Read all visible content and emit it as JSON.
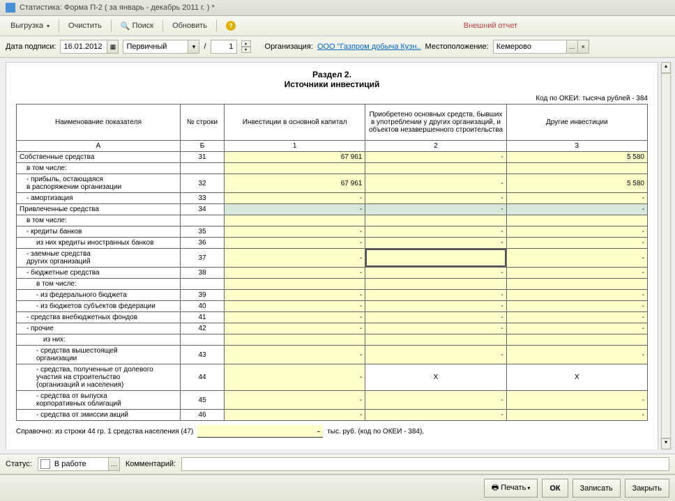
{
  "title": "Статистика: Форма П-2 ( за январь - декабрь 2011 г. ) *",
  "toolbar": {
    "export": "Выгрузка",
    "clear": "Очистить",
    "search": "Поиск",
    "refresh": "Обновить",
    "ext_report": "Внешний отчет"
  },
  "params": {
    "date_label": "Дата подписи:",
    "date_value": "16.01.2012",
    "type_value": "Первичный",
    "slash": "/",
    "number": "1",
    "org_label": "Организация:",
    "org_value": "ООО \"Газпром добыча Кузн..",
    "loc_label": "Местоположение:",
    "loc_value": "Кемерово"
  },
  "section": {
    "title": "Раздел 2.",
    "subtitle": "Источники инвестиций",
    "okei": "Код по ОКЕИ: тысяча рублей - 384"
  },
  "headers": {
    "h0": "Наименование показателя",
    "h1": "№ строки",
    "h2": "Инвестиции в основной капитал",
    "h3": "Приобретено основных средств, бывших в употреблении у других организаций, и объектов незавершенного строительства",
    "h4": "Другие инвестиции",
    "s0": "А",
    "s1": "Б",
    "s2": "1",
    "s3": "2",
    "s4": "3"
  },
  "rows": [
    {
      "name": "Собственные средства",
      "num": "31",
      "v1": "67 961",
      "v2": "-",
      "v3": "5 580",
      "ind": 0,
      "gray": false
    },
    {
      "name": "в том числе:",
      "num": "",
      "v1": "",
      "v2": "",
      "v3": "",
      "ind": 1,
      "blank": true
    },
    {
      "name": "- прибыль, остающаяся",
      "num": "",
      "v1": "",
      "v2": "",
      "v3": "",
      "ind": 1,
      "cont": true
    },
    {
      "name": "в распоряжении организации",
      "num": "32",
      "v1": "67 961",
      "v2": "-",
      "v3": "5 580",
      "ind": 1
    },
    {
      "name": "- амортизация",
      "num": "33",
      "v1": "-",
      "v2": "-",
      "v3": "-",
      "ind": 1
    },
    {
      "name": "Привлеченные средства",
      "num": "34",
      "v1": "-",
      "v2": "-",
      "v3": "-",
      "ind": 0,
      "gray": true
    },
    {
      "name": "в том числе:",
      "num": "",
      "v1": "",
      "v2": "",
      "v3": "",
      "ind": 1,
      "blank": true
    },
    {
      "name": "- кредиты банков",
      "num": "35",
      "v1": "-",
      "v2": "-",
      "v3": "-",
      "ind": 1
    },
    {
      "name": "из них кредиты иностранных банков",
      "num": "36",
      "v1": "-",
      "v2": "-",
      "v3": "-",
      "ind": 2
    },
    {
      "name": "- заемные средства",
      "num": "",
      "v1": "",
      "v2": "",
      "v3": "",
      "ind": 1,
      "cont": true
    },
    {
      "name": "других организаций",
      "num": "37",
      "v1": "-",
      "v2": "-",
      "v3": "-",
      "ind": 1,
      "sel": true
    },
    {
      "name": "- бюджетные средства",
      "num": "38",
      "v1": "-",
      "v2": "-",
      "v3": "-",
      "ind": 1
    },
    {
      "name": "в том числе:",
      "num": "",
      "v1": "",
      "v2": "",
      "v3": "",
      "ind": 2,
      "blank": true
    },
    {
      "name": "- из федерального бюджета",
      "num": "39",
      "v1": "-",
      "v2": "-",
      "v3": "-",
      "ind": 2
    },
    {
      "name": "- из бюджетов субъектов федерации",
      "num": "40",
      "v1": "-",
      "v2": "-",
      "v3": "-",
      "ind": 2
    },
    {
      "name": "- средства внебюджетных фондов",
      "num": "41",
      "v1": "-",
      "v2": "-",
      "v3": "-",
      "ind": 1
    },
    {
      "name": "- прочие",
      "num": "42",
      "v1": "-",
      "v2": "-",
      "v3": "-",
      "ind": 1
    },
    {
      "name": "из них:",
      "num": "",
      "v1": "",
      "v2": "",
      "v3": "",
      "ind": 3,
      "blank": true
    },
    {
      "name": "- средства вышестоящей",
      "num": "",
      "v1": "",
      "v2": "",
      "v3": "",
      "ind": 2,
      "cont": true
    },
    {
      "name": "организации",
      "num": "43",
      "v1": "-",
      "v2": "-",
      "v3": "-",
      "ind": 0
    },
    {
      "name": "- средства, полученные от долевого",
      "num": "",
      "v1": "",
      "v2": "",
      "v3": "",
      "ind": 2,
      "cont": true
    },
    {
      "name": "участия на строительство",
      "num": "",
      "v1": "",
      "v2": "",
      "v3": "",
      "ind": 3,
      "cont": true
    },
    {
      "name": "(организаций и населения)",
      "num": "44",
      "v1": "-",
      "v2": "X",
      "v3": "X",
      "ind": 3,
      "xcells": true
    },
    {
      "name": "- средства от выпуска",
      "num": "",
      "v1": "",
      "v2": "",
      "v3": "",
      "ind": 2,
      "cont": true
    },
    {
      "name": "корпоративных облигаций",
      "num": "45",
      "v1": "-",
      "v2": "-",
      "v3": "-",
      "ind": 3
    },
    {
      "name": "- средства от эмиссии акций",
      "num": "46",
      "v1": "-",
      "v2": "-",
      "v3": "-",
      "ind": 2
    }
  ],
  "footnote": {
    "text1": "Справочно: из строки 44 гр. 1 средства населения (47)",
    "value": "-",
    "text2": "тыс. руб. (код по ОКЕИ - 384)."
  },
  "status": {
    "label": "Статус:",
    "value": "В работе",
    "comment_label": "Комментарий:",
    "comment_value": ""
  },
  "bottom": {
    "print": "Печать",
    "ok": "ОК",
    "save": "Записать",
    "close": "Закрыть"
  }
}
